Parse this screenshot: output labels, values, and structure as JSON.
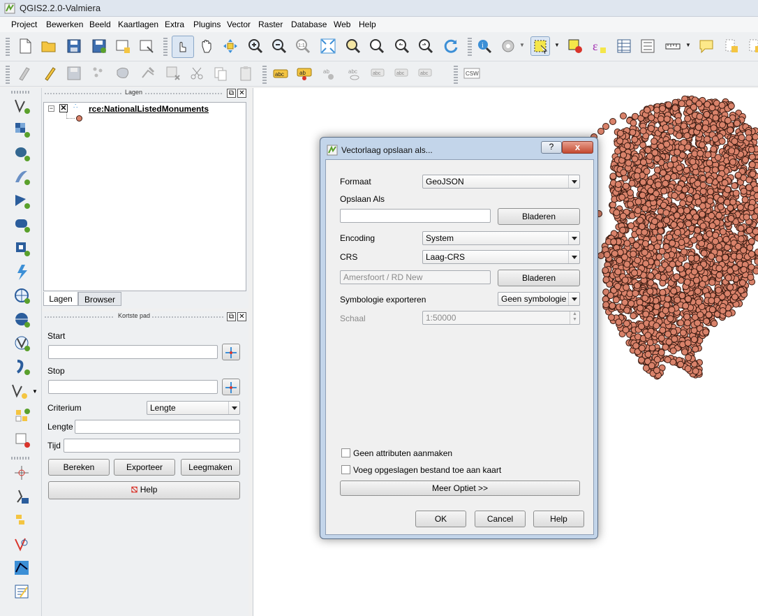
{
  "window": {
    "title": "QGIS2.2.0-Valmiera"
  },
  "menu": [
    "Project",
    "Bewerken",
    "Beeld",
    "Kaartlagen",
    "Extra",
    "Plugins",
    "Vector",
    "Raster",
    "Database",
    "Web",
    "Help"
  ],
  "layers_panel": {
    "title": "Lagen",
    "layer_name": "rce:NationalListedMonuments",
    "tabs": [
      "Lagen",
      "Browser"
    ]
  },
  "route_panel": {
    "title": "Kortste pad",
    "start_label": "Start",
    "stop_label": "Stop",
    "criterion_label": "Criterium",
    "criterion_value": "Lengte",
    "length_label": "Lengte",
    "time_label": "Tijd",
    "calc_button": "Bereken",
    "export_button": "Exporteer",
    "clear_button": "Leegmaken",
    "help_button": "Help"
  },
  "toolbar2": {
    "csw_label": "CSW",
    "abc_label": "abc",
    "ab_label": "ab"
  },
  "dialog": {
    "title": "Vectorlaag opslaan als...",
    "help_symbol": "?",
    "close_symbol": "x",
    "format_label": "Formaat",
    "format_value": "GeoJSON",
    "save_as_label": "Opslaan Als",
    "browse_button": "Bladeren",
    "encoding_label": "Encoding",
    "encoding_value": "System",
    "crs_label": "CRS",
    "crs_value": "Laag-CRS",
    "crs_field_value": "Amersfoort / RD New",
    "browse_button_2": "Bladeren",
    "symbology_label": "Symbologie exporteren",
    "symbology_value": "Geen symbologie",
    "scale_label": "Schaal",
    "scale_value": "1:50000",
    "no_attributes_label": "Geen attributen aanmaken",
    "add_to_map_label": "Voeg opgeslagen bestand toe aan kaart",
    "more_options_button": "Meer Optiet >>",
    "ok_button": "OK",
    "cancel_button": "Cancel",
    "help_button": "Help"
  },
  "colors": {
    "point_fill": "#d9826a",
    "point_stroke": "#3a1a10",
    "accent": "#3c8fd6"
  }
}
